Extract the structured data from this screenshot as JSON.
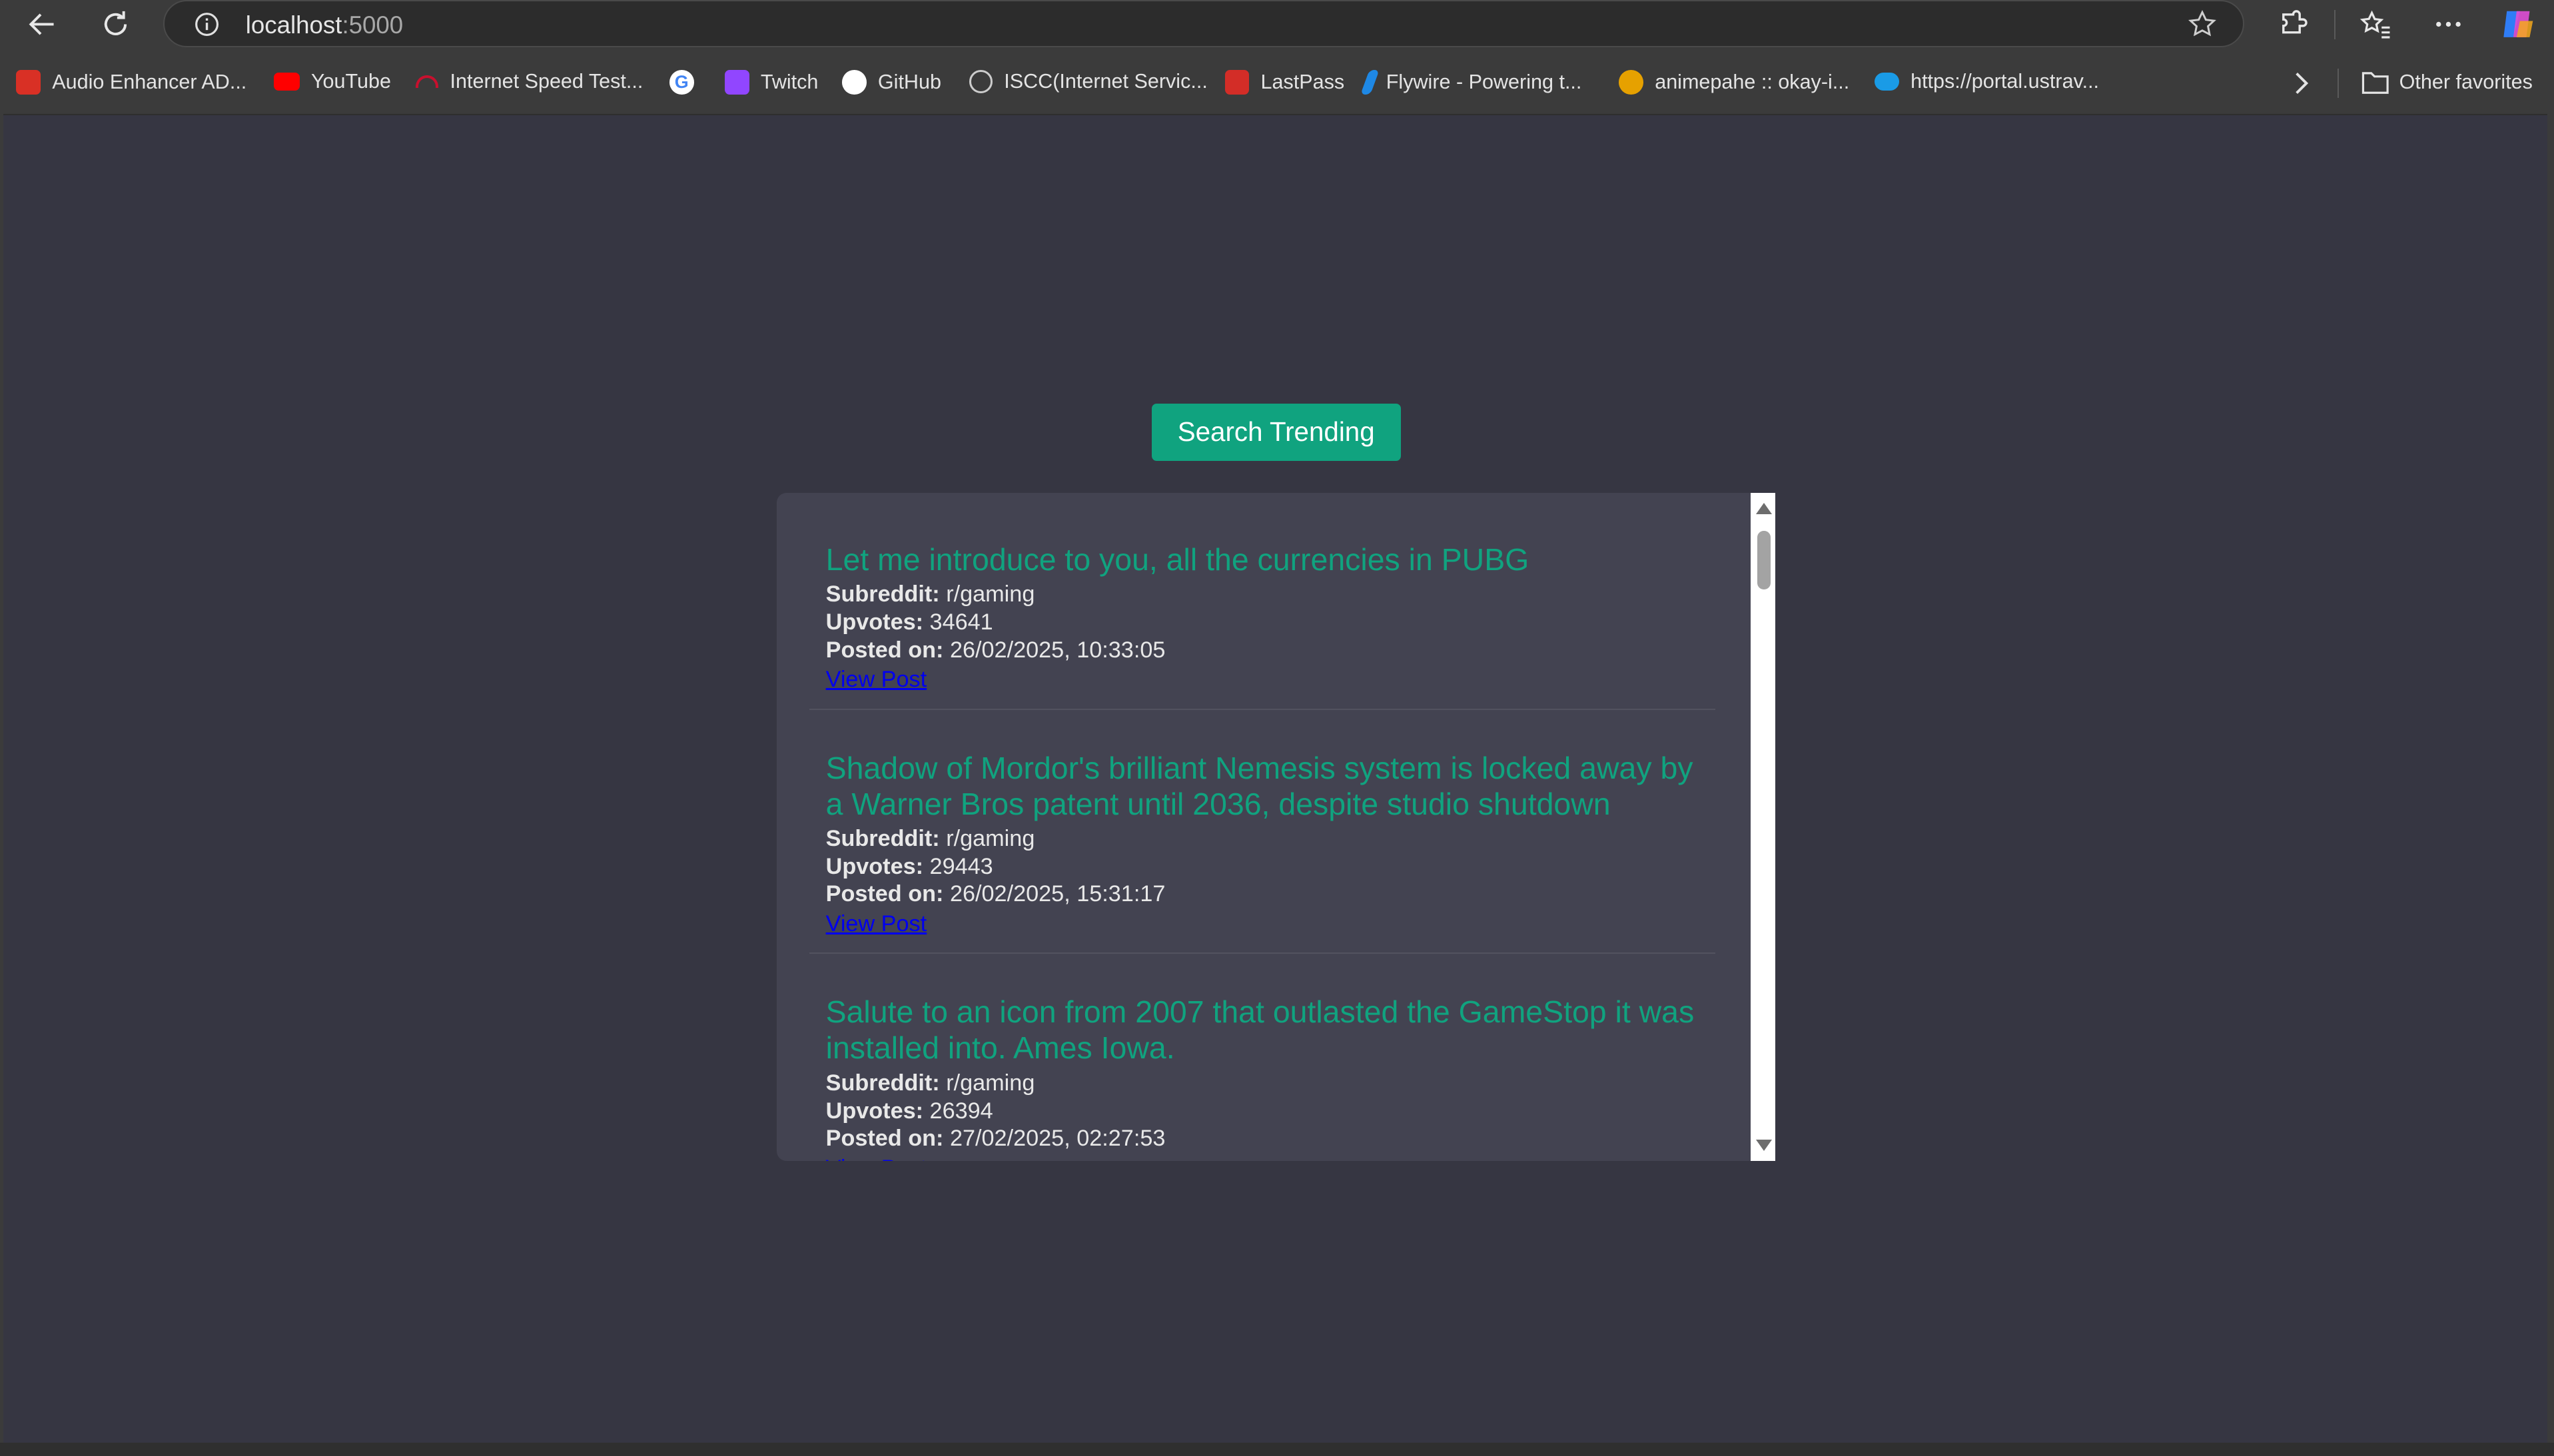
{
  "browser": {
    "url_host": "localhost",
    "url_port": ":5000",
    "bookmarks": [
      {
        "label": "Audio Enhancer AD...",
        "icon": "audio-enhancer-icon",
        "color": "#d93025"
      },
      {
        "label": "YouTube",
        "icon": "youtube-icon",
        "color": "#ff0000"
      },
      {
        "label": "Internet Speed Test...",
        "icon": "speedometer-icon",
        "color": "#c8102e"
      },
      {
        "label": "",
        "icon": "google-icon",
        "color": "#4285f4"
      },
      {
        "label": "Twitch",
        "icon": "twitch-icon",
        "color": "#9146ff"
      },
      {
        "label": "GitHub",
        "icon": "github-icon",
        "color": "#ffffff"
      },
      {
        "label": "ISCC(Internet Servic...",
        "icon": "globe-icon",
        "color": "#cccccc"
      },
      {
        "label": "LastPass",
        "icon": "lastpass-icon",
        "color": "#d32d27"
      },
      {
        "label": "Flywire - Powering t...",
        "icon": "flywire-icon",
        "color": "#1e88e5"
      },
      {
        "label": "animepahe :: okay-i...",
        "icon": "animepahe-icon",
        "color": "#e6a100"
      },
      {
        "label": "https://portal.ustrav...",
        "icon": "cloud-icon",
        "color": "#1a9be6"
      }
    ],
    "other_favorites": "Other favorites"
  },
  "page": {
    "search_button": "Search Trending",
    "labels": {
      "subreddit": "Subreddit:",
      "upvotes": "Upvotes:",
      "posted_on": "Posted on:",
      "view_post": "View Post"
    },
    "posts": [
      {
        "title": "Let me introduce to you, all the currencies in PUBG",
        "subreddit": "r/gaming",
        "upvotes": "34641",
        "posted_on": "26/02/2025, 10:33:05"
      },
      {
        "title": "Shadow of Mordor's brilliant Nemesis system is locked away by a Warner Bros patent until 2036, despite studio shutdown",
        "subreddit": "r/gaming",
        "upvotes": "29443",
        "posted_on": "26/02/2025, 15:31:17"
      },
      {
        "title": "Salute to an icon from 2007 that outlasted the GameStop it was installed into. Ames Iowa.",
        "subreddit": "r/gaming",
        "upvotes": "26394",
        "posted_on": "27/02/2025, 02:27:53"
      }
    ]
  },
  "colors": {
    "accent": "#10a37f",
    "page_bg": "#363642",
    "card_bg": "#434351",
    "link": "#0000ee"
  }
}
